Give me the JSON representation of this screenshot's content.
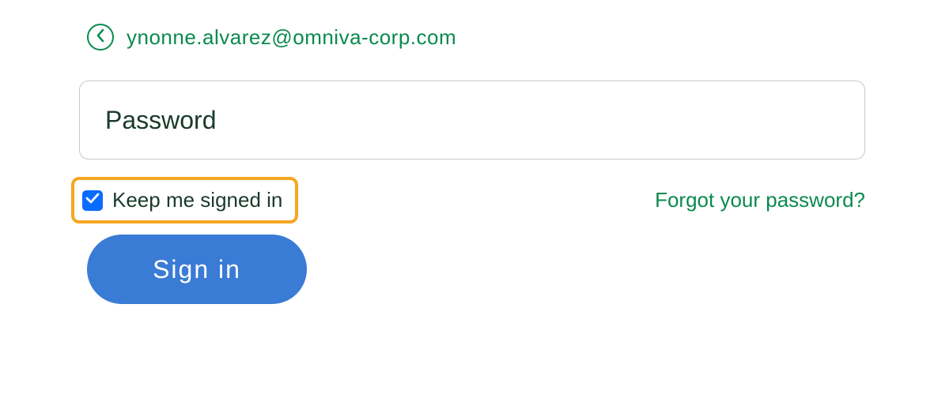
{
  "email_row": {
    "email": "ynonne.alvarez@omniva-corp.com"
  },
  "password_field": {
    "placeholder": "Password",
    "value": ""
  },
  "keep_signed": {
    "label": "Keep me signed in",
    "checked": true
  },
  "forgot_link": {
    "label": "Forgot your password?"
  },
  "signin_button": {
    "label": "Sign in"
  },
  "colors": {
    "accent_green": "#0a8a4f",
    "checkbox_blue": "#0a6bff",
    "button_blue": "#3a7bd5",
    "highlight_orange": "#f5a623"
  }
}
